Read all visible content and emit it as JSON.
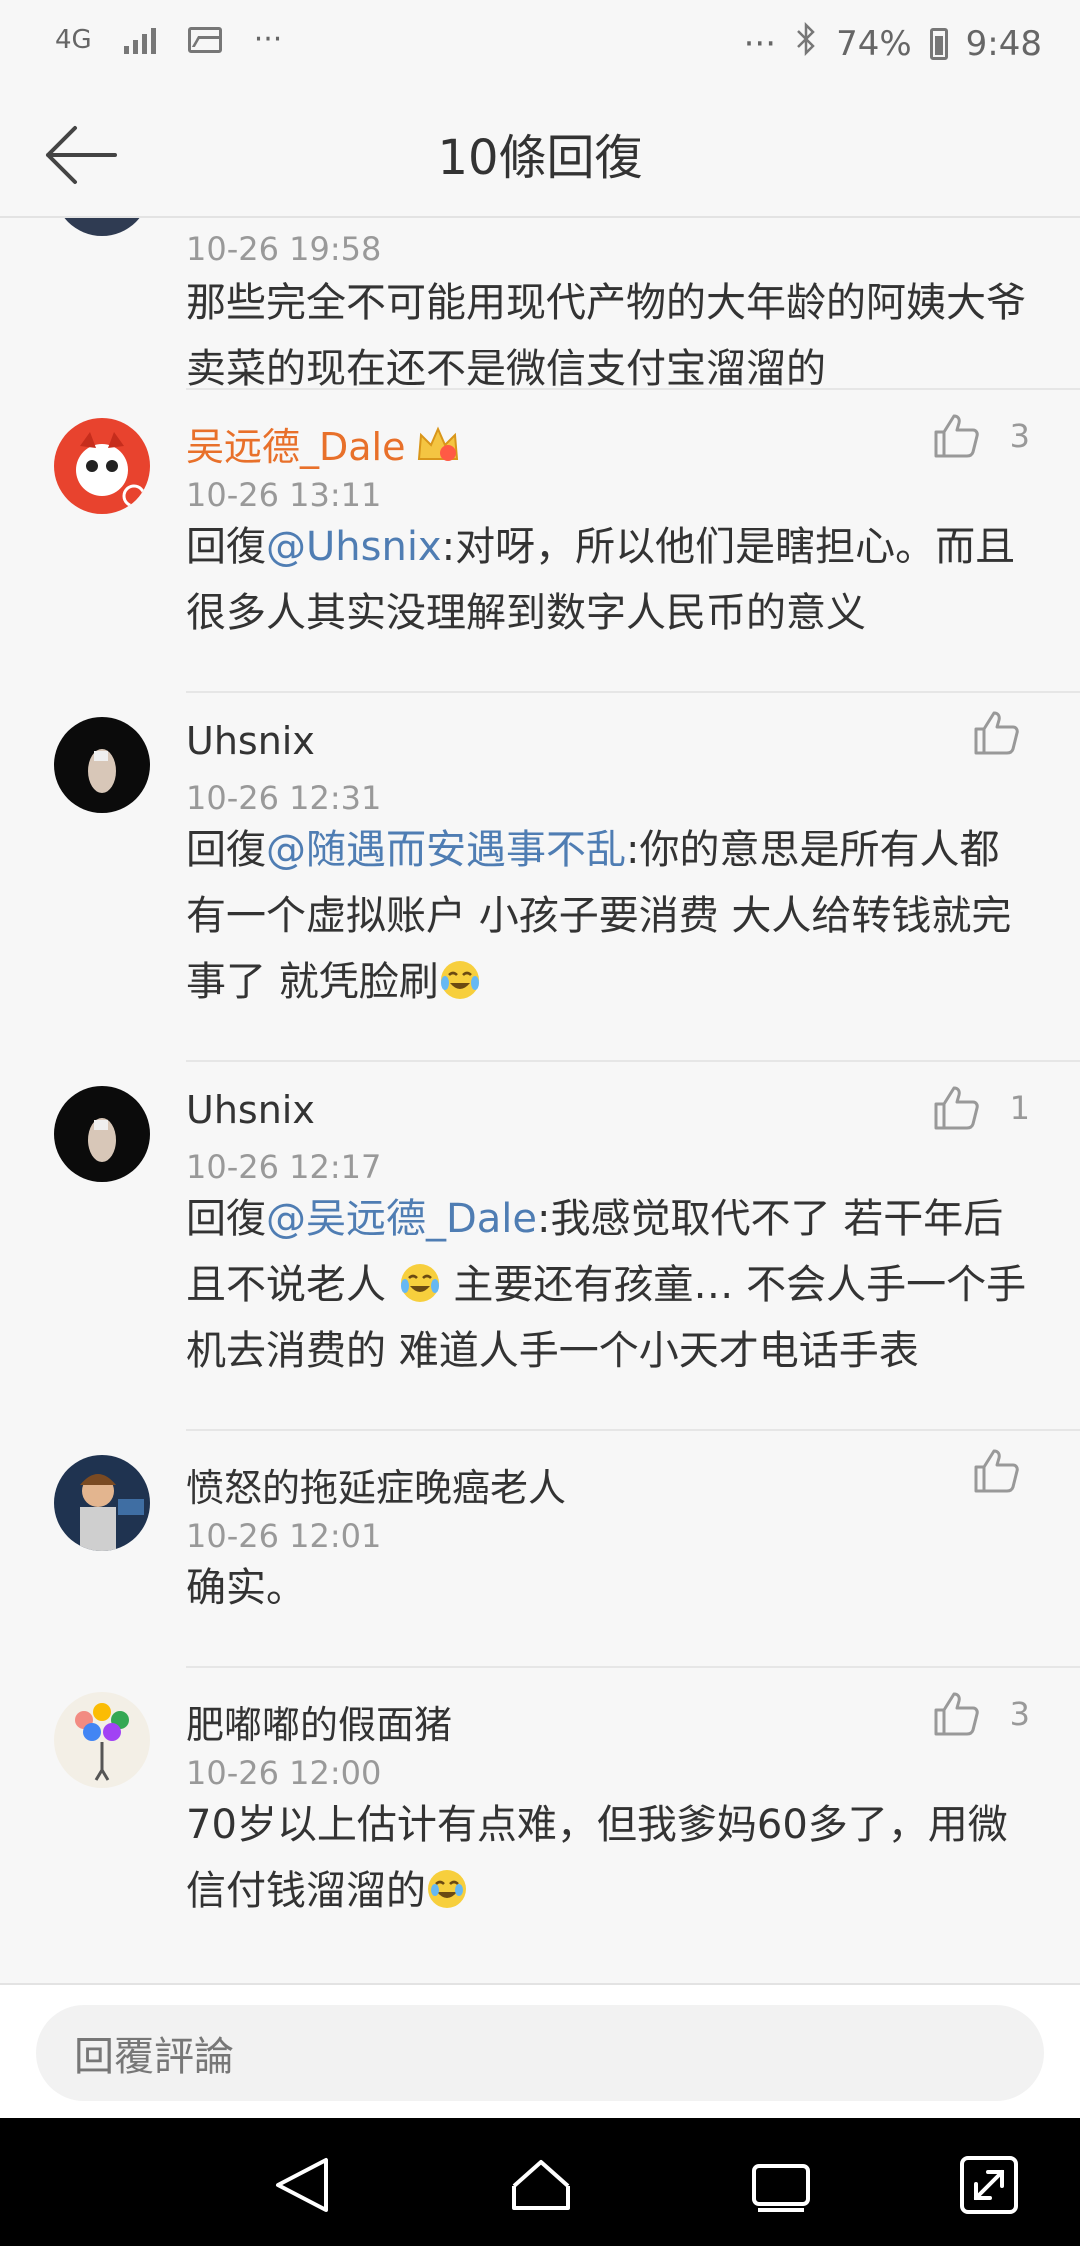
{
  "status_bar": {
    "network_label": "4G",
    "overflow_left": "···",
    "overflow_right": "···",
    "battery_percent": "74%",
    "time": "9:48",
    "battery_level": 0.74
  },
  "header": {
    "title": "10條回復"
  },
  "comments": [
    {
      "username": "",
      "time": "10-26 19:58",
      "text": "那些完全不可能用现代产物的大年龄的阿姨大爷 卖菜的现在还不是微信支付宝溜溜的",
      "likes": ""
    },
    {
      "username": "吴远德_Dale",
      "time": "10-26 13:11",
      "reply_prefix": "回復",
      "mention": "@Uhsnix",
      "text": ":对呀，所以他们是瞎担心。而且很多人其实没理解到数字人民币的意义",
      "likes": "3"
    },
    {
      "username": "Uhsnix",
      "time": "10-26 12:31",
      "reply_prefix": "回復",
      "mention": "@随遇而安遇事不乱",
      "text": ":你的意思是所有人都有一个虚拟账户 小孩子要消费 大人给转钱就完事了  就凭脸刷",
      "likes": ""
    },
    {
      "username": "Uhsnix",
      "time": "10-26 12:17",
      "reply_prefix": "回復",
      "mention": "@吴远德_Dale",
      "text_a": ":我感觉取代不了 若干年后且不说老人 ",
      "text_b": " 主要还有孩童… 不会人手一个手机去消费的 难道人手一个小天才电话手表",
      "likes": "1"
    },
    {
      "username": "愤怒的拖延症晚癌老人",
      "time": "10-26 12:01",
      "text": "确实。",
      "likes": ""
    },
    {
      "username": "肥嘟嘟的假面猪",
      "time": "10-26 12:00",
      "text": "70岁以上估计有点难，但我爹妈60多了，用微信付钱溜溜的",
      "likes": "3"
    }
  ],
  "reply_bar": {
    "placeholder": "回覆評論"
  },
  "icons": {
    "back": "arrow-left-icon",
    "like": "thumbs-up-icon",
    "crown": "crown-icon",
    "nav_back": "triangle-back-icon",
    "nav_home": "home-icon",
    "nav_recents": "recents-icon",
    "nav_expand": "expand-icon"
  },
  "colors": {
    "accent_vip": "#e8702a",
    "mention": "#4f7db3",
    "meta": "#999999"
  }
}
